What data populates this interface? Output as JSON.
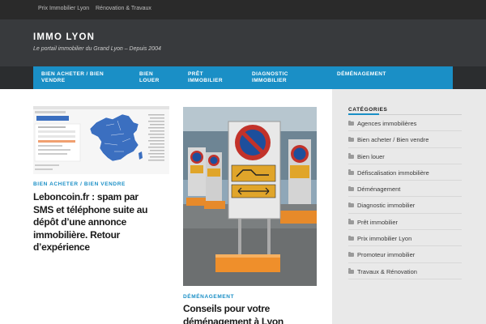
{
  "topbar": {
    "links": [
      "Prix Immobilier Lyon",
      "Rénovation & Travaux"
    ]
  },
  "header": {
    "title": "IMMO LYON",
    "tagline": "Le portail immobilier du Grand Lyon – Depuis 2004"
  },
  "nav": {
    "items": [
      {
        "line1": "BIEN ACHETER / BIEN",
        "line2": "VENDRE"
      },
      {
        "line1": "BIEN",
        "line2": "LOUER"
      },
      {
        "line1": "PRÊT",
        "line2": "IMMOBILIER"
      },
      {
        "line1": "DIAGNOSTIC",
        "line2": "IMMOBILIER"
      },
      {
        "line1": "DÉMÉNAGEMENT",
        "line2": ""
      }
    ]
  },
  "posts": [
    {
      "category": "BIEN ACHETER / BIEN VENDRE",
      "title_lines": [
        "Leboncoin.fr : spam par",
        "SMS et téléphone suite au",
        "dépôt d’une annonce",
        "immobilière. Retour",
        "d’expérience"
      ]
    },
    {
      "category": "DÉMÉNAGEMENT",
      "title_lines": [
        "Conseils pour votre",
        "déménagement à Lyon"
      ]
    }
  ],
  "sidebar": {
    "title": "CATÉGORIES",
    "items": [
      "Agences immobilières",
      "Bien acheter / Bien vendre",
      "Bien louer",
      "Défiscalisation immobilière",
      "Déménagement",
      "Diagnostic immobilier",
      "Prêt immobilier",
      "Prix immobilier Lyon",
      "Promoteur immobilier",
      "Travaux & Rénovation"
    ]
  },
  "colors": {
    "accent": "#1a8fc6",
    "header_bg": "#383a3d",
    "topbar_bg": "#2a2a2a"
  }
}
